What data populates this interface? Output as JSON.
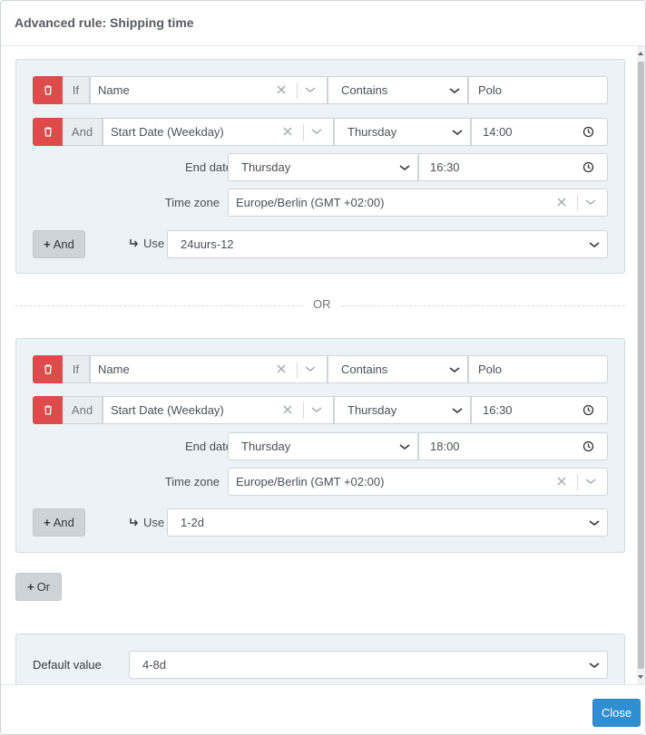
{
  "modal": {
    "title": "Advanced rule: Shipping time"
  },
  "rules": [
    {
      "condition1": {
        "prefix": "If",
        "field": "Name",
        "operator": "Contains",
        "value": "Polo"
      },
      "condition2": {
        "prefix": "And",
        "field": "Start Date (Weekday)",
        "weekday": "Thursday",
        "time": "14:00"
      },
      "end_date": {
        "label": "End date",
        "weekday": "Thursday",
        "time": "16:30"
      },
      "time_zone": {
        "label": "Time zone",
        "value": "Europe/Berlin (GMT +02:00)"
      },
      "and_button": "And",
      "use": {
        "label": "Use",
        "value": "24uurs-12"
      }
    },
    {
      "condition1": {
        "prefix": "If",
        "field": "Name",
        "operator": "Contains",
        "value": "Polo"
      },
      "condition2": {
        "prefix": "And",
        "field": "Start Date (Weekday)",
        "weekday": "Thursday",
        "time": "16:30"
      },
      "end_date": {
        "label": "End date",
        "weekday": "Thursday",
        "time": "18:00"
      },
      "time_zone": {
        "label": "Time zone",
        "value": "Europe/Berlin (GMT +02:00)"
      },
      "and_button": "And",
      "use": {
        "label": "Use",
        "value": "1-2d"
      }
    }
  ],
  "divider_text": "OR",
  "or_button": "Or",
  "default": {
    "label": "Default value",
    "value": "4-8d"
  },
  "footer": {
    "close_label": "Close"
  },
  "colors": {
    "danger": "#dd4b4b",
    "primary": "#2f8fd2",
    "panel": "#ecf2f6"
  },
  "icons": {
    "delete": "trash-icon",
    "clear": "close-icon",
    "dropdown": "chevron-down-icon",
    "time": "clock-icon",
    "use": "share-arrow-icon",
    "add": "plus-icon"
  }
}
